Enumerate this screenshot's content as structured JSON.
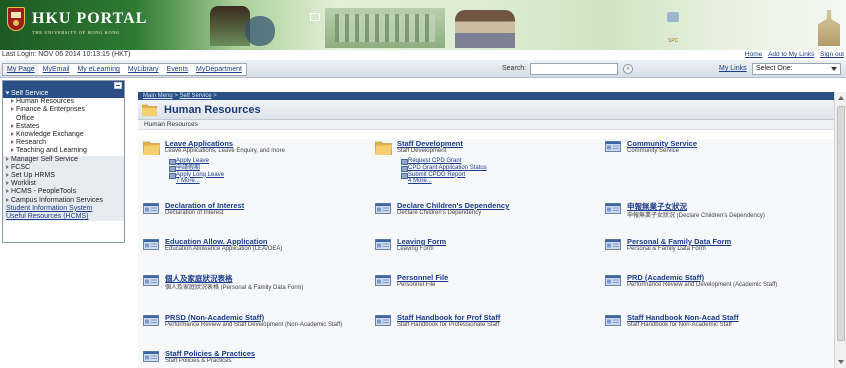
{
  "banner": {
    "title": "HKU PORTAL",
    "subtitle": "THE UNIVERSITY OF HONG KONG",
    "mini_label": "SPC"
  },
  "last_login": "Last Login: NOV 06 2014 10:13:15 (HKT)",
  "top_links": [
    "Home",
    "Add to My Links",
    "Sign out"
  ],
  "nav": {
    "tabs": [
      "My Page",
      "MyEmail",
      "My eLearning",
      "MyLibrary",
      "Events",
      "MyDepartment"
    ],
    "search_label": "Search:",
    "search_value": "",
    "search_go": "»",
    "my_links": "My Links",
    "select_value": "Select One:"
  },
  "left_menu": [
    {
      "label": "Self Service",
      "style": "sel"
    },
    {
      "label": "Human Resources",
      "style": "sub"
    },
    {
      "label": "Finance & Enterprises",
      "style": "sub"
    },
    {
      "label": "Office",
      "style": "sub2"
    },
    {
      "label": "Estates",
      "style": "sub"
    },
    {
      "label": "Knowledge Exchange",
      "style": "sub"
    },
    {
      "label": "Research",
      "style": "sub"
    },
    {
      "label": "Teaching and Learning",
      "style": "sub"
    },
    {
      "label": "Manager Self Service",
      "style": "grey"
    },
    {
      "label": "FCSC",
      "style": "grey"
    },
    {
      "label": "Set Up HRMS",
      "style": "grey"
    },
    {
      "label": "Worklist",
      "style": "grey"
    },
    {
      "label": "HCMS - PeopleTools",
      "style": "grey"
    },
    {
      "label": "Campus Information Services",
      "style": "grey"
    },
    {
      "label": "Student Information System",
      "style": "link"
    },
    {
      "label": "Useful Resources (HCMS)",
      "style": "link"
    }
  ],
  "content": {
    "breadcrumb": [
      "Main Menu",
      "Self Service"
    ],
    "page_title": "Human Resources",
    "section_label": "Human Resources",
    "cards": [
      {
        "title": "Leave Applications",
        "desc": "Leave Applications, Leave Enquiry, and more",
        "icon": "folder-icon",
        "sublinks": [
          "Apply Leave",
          "申請假期",
          "Apply Long Leave",
          "7 More..."
        ]
      },
      {
        "title": "Staff Development",
        "desc": "Staff Development",
        "icon": "folder-icon",
        "sublinks": [
          "Request CPD Grant",
          "CPD Grant Application Status",
          "Submit CPDG Report",
          "4 More..."
        ]
      },
      {
        "title": "Community Service",
        "desc": "Community Service",
        "icon": "page-icon",
        "sublinks": []
      },
      {
        "title": "Declaration of Interest",
        "desc": "Declaration of Interest",
        "icon": "page-icon",
        "sublinks": []
      },
      {
        "title": "Declare Children's Dependency",
        "desc": "Declare Children's Dependency",
        "icon": "page-icon",
        "sublinks": []
      },
      {
        "title": "申報無業子女狀況",
        "desc": "申報無業子女狀況 (Declare Children's Dependency)",
        "icon": "page-icon",
        "sublinks": []
      },
      {
        "title": "Education Allow. Application",
        "desc": "Education Allowance Application (LEA/OEA)",
        "icon": "page-icon",
        "sublinks": []
      },
      {
        "title": "Leaving Form",
        "desc": "Leaving Form",
        "icon": "page-icon",
        "sublinks": []
      },
      {
        "title": "Personal & Family Data Form",
        "desc": "Personal & Family Data Form",
        "icon": "page-icon",
        "sublinks": []
      },
      {
        "title": "個人及家庭狀況表格",
        "desc": "個人及家庭狀況表格 (Personal & Family Data Form)",
        "icon": "page-icon",
        "sublinks": []
      },
      {
        "title": "Personnel File",
        "desc": "Personnel File",
        "icon": "page-icon",
        "sublinks": []
      },
      {
        "title": "PRD (Academic Staff)",
        "desc": "Performance Review and Development (Academic Staff)",
        "icon": "page-icon",
        "sublinks": []
      },
      {
        "title": "PRSD (Non-Academic Staff)",
        "desc": "Performance Review and Staff Development (Non-Academic Staff)",
        "icon": "page-icon",
        "sublinks": []
      },
      {
        "title": "Staff Handbook for Prof Staff",
        "desc": "Staff Handbook for Professionate Staff",
        "icon": "page-icon",
        "sublinks": []
      },
      {
        "title": "Staff Handbook Non-Acad Staff",
        "desc": "Staff Handbook for Non-Academic Staff",
        "icon": "page-icon",
        "sublinks": []
      },
      {
        "title": "Staff Policies & Practices",
        "desc": "Staff Policies & Practices",
        "icon": "page-icon",
        "sublinks": []
      }
    ]
  },
  "colors": {
    "accent": "#2a4f85",
    "link": "#1a3c8c",
    "banner_green": "#1e5a23"
  }
}
